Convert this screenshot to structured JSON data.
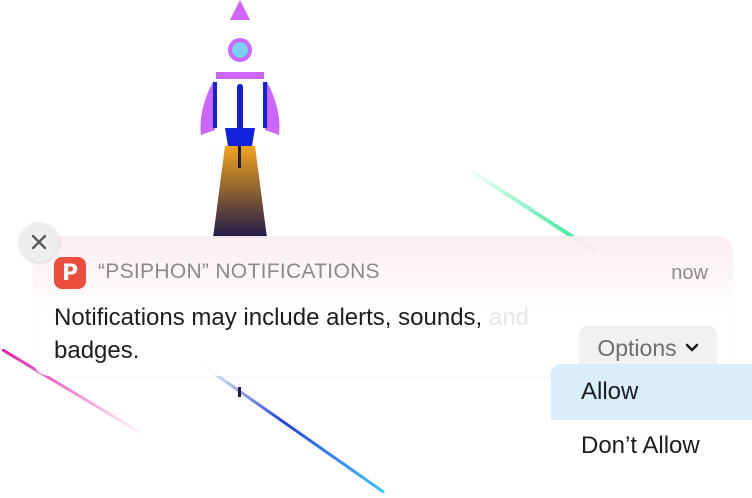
{
  "notification": {
    "app_name": "“PSIPHON” NOTIFICATIONS",
    "time": "now",
    "message_main": "Notifications may include alerts, sounds,",
    "message_faded": " and",
    "message_end": "badges.",
    "options_label": "Options",
    "app_icon_letter": "P"
  },
  "menu": {
    "items": [
      {
        "label": "Allow",
        "selected": true
      },
      {
        "label": "Don’t Allow",
        "selected": false
      }
    ]
  },
  "colors": {
    "app_icon": "#ea4f3d",
    "selected_item": "#daedfb",
    "rocket_body": "#cc66ff",
    "rocket_blue": "#1122dd",
    "flame_top": "#f2a31b",
    "flame_bottom": "#1f1a4a"
  }
}
